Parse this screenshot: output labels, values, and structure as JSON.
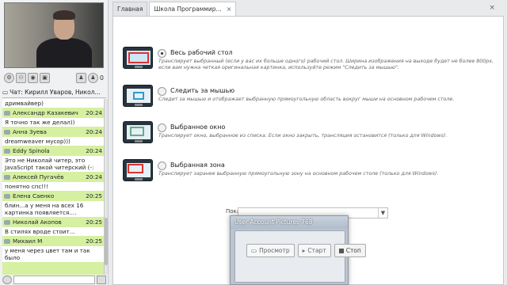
{
  "video": {
    "participant_count": "0"
  },
  "chat": {
    "header": "Чат: Кирилл Уваров, Никол...",
    "messages": [
      {
        "name": "",
        "time": "",
        "text": "дримвайвер)"
      },
      {
        "name": "Александр Казакевич",
        "time": "20:24",
        "text": "Я точно так же делал))"
      },
      {
        "name": "Анна Зуева",
        "time": "20:24",
        "text": "dreamweaver мусор)))"
      },
      {
        "name": "Eddy Spinola",
        "time": "20:24",
        "text": "Это не Николай читер, это JavaScript такой читерский (-:"
      },
      {
        "name": "Алексей Пугачёв",
        "time": "20:24",
        "text": "понятно спс!!!"
      },
      {
        "name": "Елена Саенко",
        "time": "20:25",
        "text": "блин...а у меня на всех 16 картинка появляется...."
      },
      {
        "name": "Николай Акопов",
        "time": "20:25",
        "text": "В стилях вроде стоит..."
      },
      {
        "name": "Михаил М",
        "time": "20:25",
        "text": "у меня через цвет там и так было"
      }
    ]
  },
  "tabs": [
    {
      "label": "Главная"
    },
    {
      "label": "Школа Программир..."
    }
  ],
  "options": [
    {
      "label": "Весь рабочий стол",
      "selected": true,
      "desc": "Транслирует выбранный (если у вас их больше одного) рабочий стол. Ширина изображения на выходе будет не более 800px, если вам нужна четкая оригинальная картинка, используйте режим \"Следить за мышью\"."
    },
    {
      "label": "Следить за мышью",
      "selected": false,
      "desc": "Следит за мышью и отображает выбранную прямоугольную область вокруг мыши на основном рабочем столе."
    },
    {
      "label": "Выбранное окно",
      "selected": false,
      "desc": "Транслирует окно, выбранное из списка. Если окно закрыть, трансляция остановится (только для Windows)."
    },
    {
      "label": "Выбранная зона",
      "selected": false,
      "desc": "Транслирует заранее выбранную прямоугольную зону на основном рабочем столе (только для Windows)."
    }
  ],
  "show_label": "Показывать:",
  "overlay_title": "User Account Pictures 768",
  "buttons": {
    "preview": "Просмотр",
    "start": "Старт",
    "stop": "Стоп"
  }
}
